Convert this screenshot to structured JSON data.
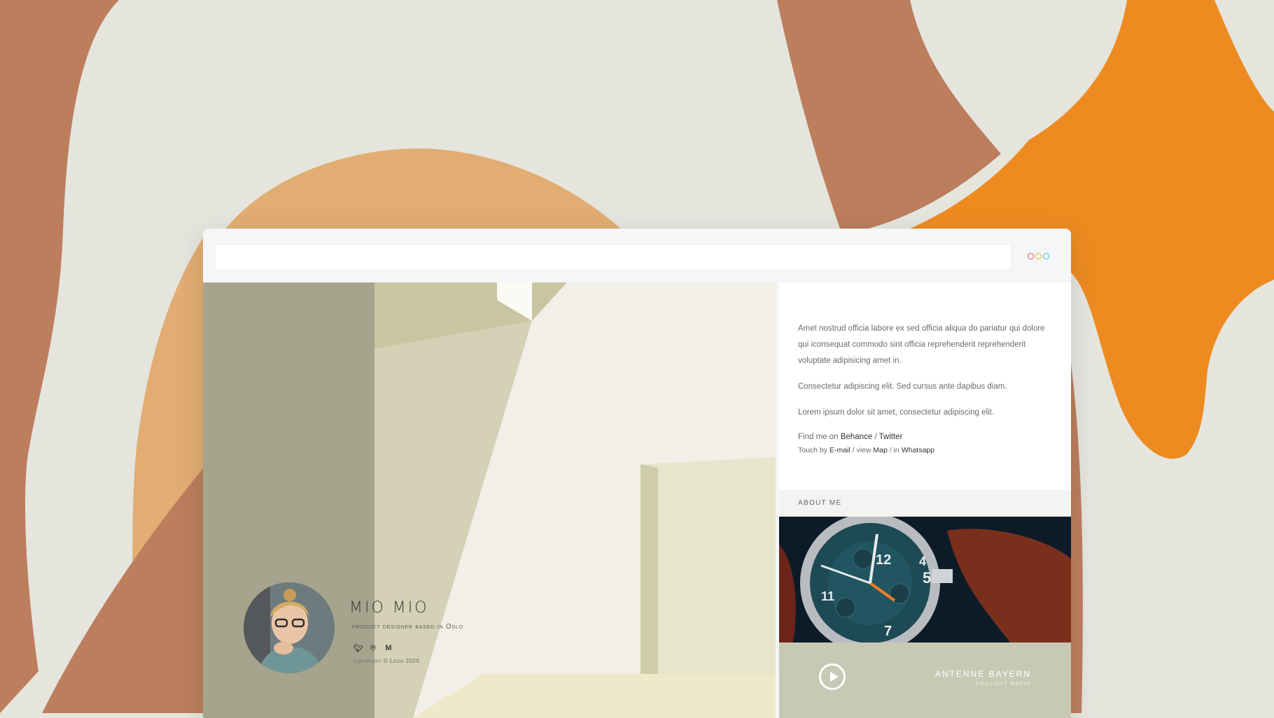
{
  "browser": {
    "address_value": "",
    "window_dots": [
      "#e0524a",
      "#f0b32a",
      "#3fbed3"
    ]
  },
  "profile": {
    "name": "MIO MIO",
    "role_prefix": "product designer based in ",
    "role_city": "Oslo",
    "social_icons": [
      "twitter-icon",
      "pinterest-icon",
      "medium-icon"
    ],
    "copyright": "copyright © Lego 2020"
  },
  "sidebar": {
    "paragraphs": [
      "Amet nostrud officia labore ex sed officia aliqua do pariatur qui dolore qui iconsequat commodo sint officia reprehenderit reprehenderit voluptate adipisicing amet in.",
      "Consectetur adipiscing elit. Sed cursus ante dapibus diam.",
      "Lorem ipsum dolor sit amet, consectetur adipiscing elit."
    ],
    "find_prefix": "Find me on ",
    "behance": "Behance",
    "slash": " / ",
    "twitter": "Twitter",
    "touch_prefix": "Touch by ",
    "email": "E-mail",
    "view_prefix": " / view ",
    "map": "Map",
    "in_prefix": " / in ",
    "whatsapp": "Whatsapp",
    "about_label": "ABOUT ME",
    "radio": {
      "station": "ANTENNE BAYERN",
      "subtitle": "CHILLOUT RADIO"
    }
  },
  "colors": {
    "background": "#e5e5de",
    "rust": "#bc7e5d",
    "sand": "#e1ad72",
    "orange": "#ed8b21",
    "radio_panel": "#c8c9b4"
  }
}
